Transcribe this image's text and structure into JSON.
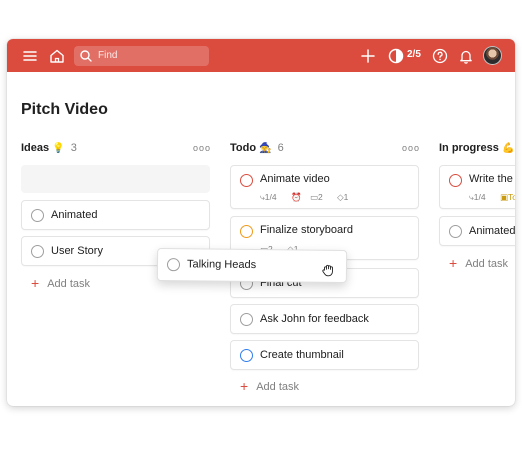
{
  "topbar": {
    "background": "#db4c3f",
    "search_placeholder": "Find",
    "karma_count": "2/5",
    "icons": [
      "menu-icon",
      "home-icon",
      "search-icon",
      "add-icon",
      "karma-icon",
      "help-icon",
      "bell-icon",
      "avatar"
    ]
  },
  "project": {
    "title": "Pitch Video"
  },
  "columns": [
    {
      "title": "Ideas",
      "emoji": "💡",
      "count": "3",
      "more": "ooo",
      "tasks": [
        {
          "name": "Animated",
          "priority_color": "#9e9e9e"
        },
        {
          "name": "User Story",
          "priority_color": "#9e9e9e"
        }
      ],
      "add_task": "Add task"
    },
    {
      "title": "Todo",
      "emoji": "🧙",
      "count": "6",
      "more": "ooo",
      "tasks": [
        {
          "name": "Animate video",
          "priority_color": "#db4c3f",
          "subtasks": "1/4",
          "comments": "2",
          "labels": "1"
        },
        {
          "name": "Finalize storyboard",
          "priority_color": "#f09a1a",
          "comments": "2",
          "labels": "1"
        },
        {
          "name": "Final cut",
          "priority_color": "#9e9e9e"
        },
        {
          "name": "Ask John for feedback",
          "priority_color": "#9e9e9e"
        },
        {
          "name": "Create thumbnail",
          "priority_color": "#2f7ef0"
        }
      ],
      "add_task": "Add task"
    },
    {
      "title": "In progress",
      "emoji": "💪",
      "tasks": [
        {
          "name": "Write the",
          "priority_color": "#db4c3f",
          "subtasks": "1/4",
          "date_label": "To"
        },
        {
          "name": "Animated",
          "priority_color": "#9e9e9e"
        }
      ],
      "add_task": "Add task"
    }
  ],
  "dragging_task": {
    "name": "Talking Heads"
  }
}
